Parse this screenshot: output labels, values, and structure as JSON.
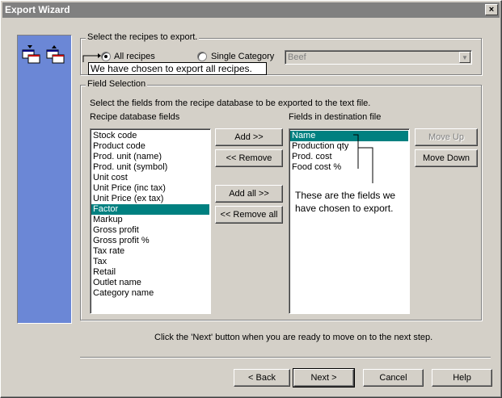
{
  "window": {
    "title": "Export Wizard",
    "close_glyph": "×"
  },
  "recipes_group": {
    "title": "Select the recipes to export.",
    "all_recipes_label": "All recipes",
    "single_category_label": "Single Category",
    "selected_option": "All recipes",
    "category_value": "Beef",
    "tooltip": "We have chosen to export all recipes."
  },
  "field_group": {
    "title": "Field Selection",
    "instruction": "Select the fields from the recipe database to be exported to the text file.",
    "source_header": "Recipe database fields",
    "dest_header": "Fields in destination file",
    "source_fields": [
      "Stock code",
      "Product code",
      "Prod. unit (name)",
      "Prod. unit (symbol)",
      "Unit cost",
      "Unit Price (inc tax)",
      "Unit Price (ex tax)",
      "Factor",
      "Markup",
      "Gross profit",
      "Gross profit %",
      "Tax rate",
      "Tax",
      "Retail",
      "Outlet name",
      "Category name"
    ],
    "source_selected": "Factor",
    "dest_fields": [
      "Name",
      "Production qty",
      "Prod. cost",
      "Food cost %"
    ],
    "dest_selected": "Name",
    "note": "These are the fields we have chosen to export."
  },
  "buttons": {
    "add": "Add >>",
    "remove": "<< Remove",
    "add_all": "Add all >>",
    "remove_all": "<< Remove all",
    "move_up": "Move Up",
    "move_down": "Move Down"
  },
  "footer": {
    "hint": "Click the 'Next' button when you are ready to move on to the next step.",
    "back": "< Back",
    "next": "Next >",
    "cancel": "Cancel",
    "help": "Help"
  },
  "colors": {
    "side_panel": "#6b87d6",
    "selection": "#008080",
    "titlebar": "#808080"
  },
  "icons": [
    "wizard-step-up-icon",
    "wizard-step-down-icon",
    "dropdown-arrow-icon"
  ]
}
